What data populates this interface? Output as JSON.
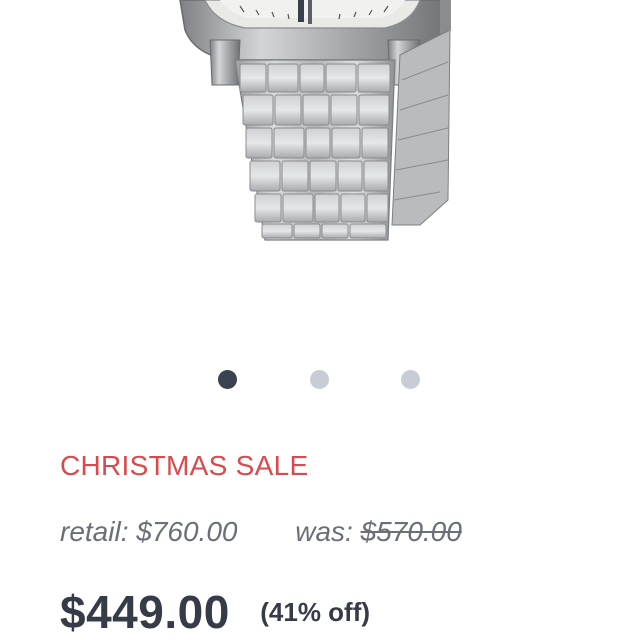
{
  "product": {
    "image_alt": "stainless steel watch with metal link bracelet"
  },
  "carousel": {
    "slide_count": 3,
    "active_index": 0,
    "dot_active_color": "#3a4250",
    "dot_inactive_color": "#c8cdd5"
  },
  "promo": {
    "label": "CHRISTMAS SALE",
    "color": "#d94a4e"
  },
  "pricing": {
    "retail_label": "retail:",
    "retail_price": "$760.00",
    "was_label": "was:",
    "was_price": "$570.00",
    "final_price": "$449.00",
    "discount_text": "(41% off)"
  }
}
